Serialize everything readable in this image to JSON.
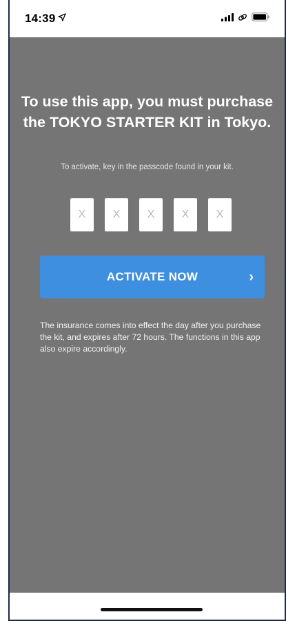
{
  "status_bar": {
    "time": "14:39",
    "icons": [
      "location-arrow-icon",
      "signal-icon",
      "link-icon",
      "battery-icon"
    ]
  },
  "main": {
    "headline": "To use this app, you must purchase the TOKYO STARTER KIT in Tokyo.",
    "subtext": "To activate, key in the passcode found in your kit.",
    "passcode": {
      "placeholders": [
        "X",
        "X",
        "X",
        "X",
        "X"
      ]
    },
    "activate_button": {
      "label": "ACTIVATE NOW",
      "chevron": "›"
    },
    "note": "The insurance comes into effect the day after you purchase the kit, and expires after 72 hours. The functions in this app also expire accordingly."
  },
  "colors": {
    "background": "#757575",
    "button": "#3f8fe0",
    "text": "#ffffff"
  }
}
